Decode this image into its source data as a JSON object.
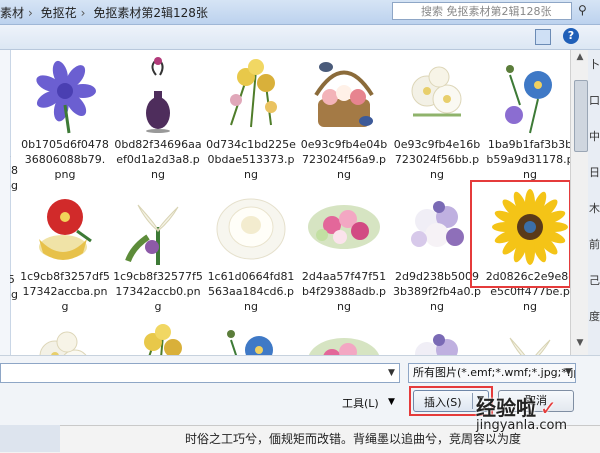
{
  "breadcrumb": {
    "items": [
      "素材",
      "免抠花",
      "免抠素材第2辑128张"
    ]
  },
  "search": {
    "placeholder": "搜索 免抠素材第2辑128张"
  },
  "toolbar": {
    "help": "?"
  },
  "files": [
    {
      "name": "0b1705d6f0478 36806088b79.png",
      "lines": [
        "0b1705d6f0478",
        "36806088b79.",
        "png"
      ],
      "icon": "purple-flower-bouquet"
    },
    {
      "name": "0bd82f34696aaef0d1a2d3a8.png",
      "lines": [
        "0bd82f34696aa",
        "ef0d1a2d3a8.p",
        "ng"
      ],
      "icon": "flower-vase"
    },
    {
      "name": "0d734c1bd225e0bdae513373.png",
      "lines": [
        "0d734c1bd225e",
        "0bdae513373.p",
        "ng"
      ],
      "icon": "daisy-sprigs"
    },
    {
      "name": "0e93c9fb4e04b723024f56a9.png",
      "lines": [
        "0e93c9fb4e04b",
        "723024f56a9.p",
        "ng"
      ],
      "icon": "flower-basket-birds"
    },
    {
      "name": "0e93c9fb4e16b723024f56bb.png",
      "lines": [
        "0e93c9fb4e16b",
        "723024f56bb.p",
        "ng"
      ],
      "icon": "white-flowers"
    },
    {
      "name": "1ba9b1faf3b3bb59a9d31178.png",
      "lines": [
        "1ba9b1faf3b3b",
        "b59a9d31178.p",
        "ng"
      ],
      "icon": "blue-flower"
    },
    {
      "name": "1c9cb8f3257df517342accba.png",
      "lines": [
        "1c9cb8f3257df5",
        "17342accba.pn",
        "g"
      ],
      "icon": "red-flower-cup"
    },
    {
      "name": "1c9cb8f32577f517342accb0.png",
      "lines": [
        "1c9cb8f32577f5",
        "17342accb0.pn",
        "g"
      ],
      "icon": "lily-bouquet"
    },
    {
      "name": "1c61d0664fd81563aa184cd6.png",
      "lines": [
        "1c61d0664fd81",
        "563aa184cd6.p",
        "ng"
      ],
      "icon": "white-rose"
    },
    {
      "name": "2d4aa57f47f51b4f29388adb.png",
      "lines": [
        "2d4aa57f47f51",
        "b4f29388adb.p",
        "ng"
      ],
      "icon": "pink-bouquet"
    },
    {
      "name": "2d9d238b50093b389f2fb4a0.png",
      "lines": [
        "2d9d238b5009",
        "3b389f2fb4a0.p",
        "ng"
      ],
      "icon": "mixed-bouquet"
    },
    {
      "name": "2d0826c2e9e8ce5c0ff477be.png",
      "lines": [
        "2d0826c2e9e8c",
        "e5c0ff477be.p",
        "ng"
      ],
      "icon": "sunflower",
      "selected": true
    }
  ],
  "left_cut": [
    "3",
    "78",
    "ng",
    "f5",
    "ng",
    "g"
  ],
  "right_cut": [
    "卜",
    "口",
    "中",
    "日",
    "木",
    "前",
    "己",
    "度"
  ],
  "filter": {
    "value": "所有图片(*.emf;*.wmf;*.jpg;*.jp"
  },
  "buttons": {
    "tools": "工具(L)",
    "insert": "插入(S)",
    "cancel": "取消"
  },
  "document": {
    "text": "时俗之工巧兮，偭规矩而改错。背绳墨以追曲兮，竞周容以为度"
  },
  "watermark": {
    "line1": "经验啦",
    "line2": "jingyanla.com",
    "check": "✓"
  },
  "colors": {
    "highlight": "#e53b3b",
    "chrome": "#d6e4f5"
  }
}
